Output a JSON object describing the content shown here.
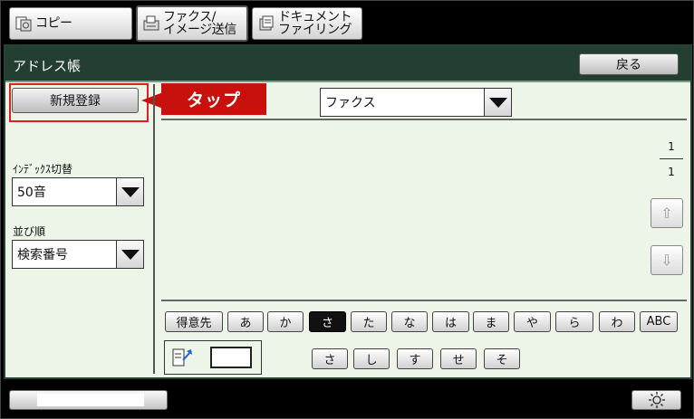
{
  "tabs": [
    {
      "label": "コピー",
      "icon": "copy-icon"
    },
    {
      "label": "ファクス/\nイメージ送信",
      "icon": "fax-icon"
    },
    {
      "label": "ドキュメント\nファイリング",
      "icon": "document-filing-icon"
    }
  ],
  "header": {
    "title": "アドレス帳",
    "back_label": "戻る"
  },
  "new_registration": {
    "label": "新規登録"
  },
  "callout": {
    "label": "タップ"
  },
  "destination_select": {
    "value": "ファクス"
  },
  "sidebar": {
    "index_label": "ｲﾝﾃﾞｯｸｽ切替",
    "index_value": "50音",
    "sort_label": "並び順",
    "sort_value": "検索番号"
  },
  "pager": {
    "current": "1",
    "total": "1"
  },
  "index_keys": [
    "得意先",
    "あ",
    "か",
    "さ",
    "た",
    "な",
    "は",
    "ま",
    "や",
    "ら",
    "わ",
    "ABC"
  ],
  "selected_index_key": "さ",
  "sub_keys": [
    "さ",
    "し",
    "す",
    "せ",
    "そ"
  ],
  "colors": {
    "panel_bg": "#ecf5e8",
    "titlebar": "#233f31",
    "callout": "#c8100c",
    "highlight_frame": "#e02020"
  }
}
